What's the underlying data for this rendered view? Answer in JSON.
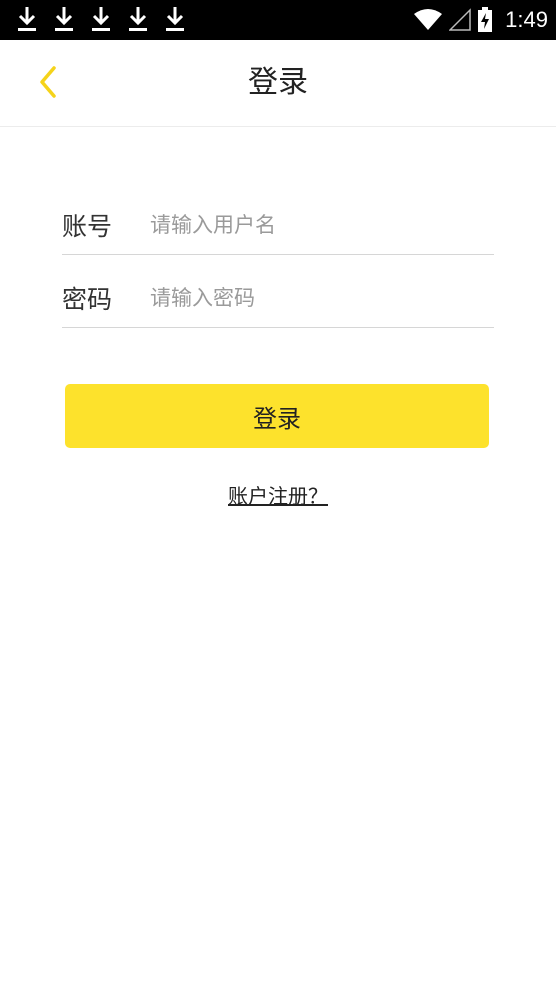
{
  "status_bar": {
    "time": "1:49",
    "notification_icons": [
      "download-icon",
      "download-icon",
      "download-icon",
      "download-icon",
      "download-icon"
    ],
    "indicator_icons": [
      "wifi-icon",
      "signal-icon",
      "battery-charging-icon"
    ]
  },
  "nav": {
    "title": "登录",
    "back_icon": "chevron-left-icon"
  },
  "form": {
    "account_label": "账号",
    "account_placeholder": "请输入用户名",
    "account_value": "",
    "password_label": "密码",
    "password_placeholder": "请输入密码",
    "password_value": ""
  },
  "login_button_label": "登录",
  "register_link": "账户注册？",
  "colors": {
    "accent": "#fde22c",
    "back_arrow": "#f5d31a",
    "status_bar": "#000000"
  }
}
